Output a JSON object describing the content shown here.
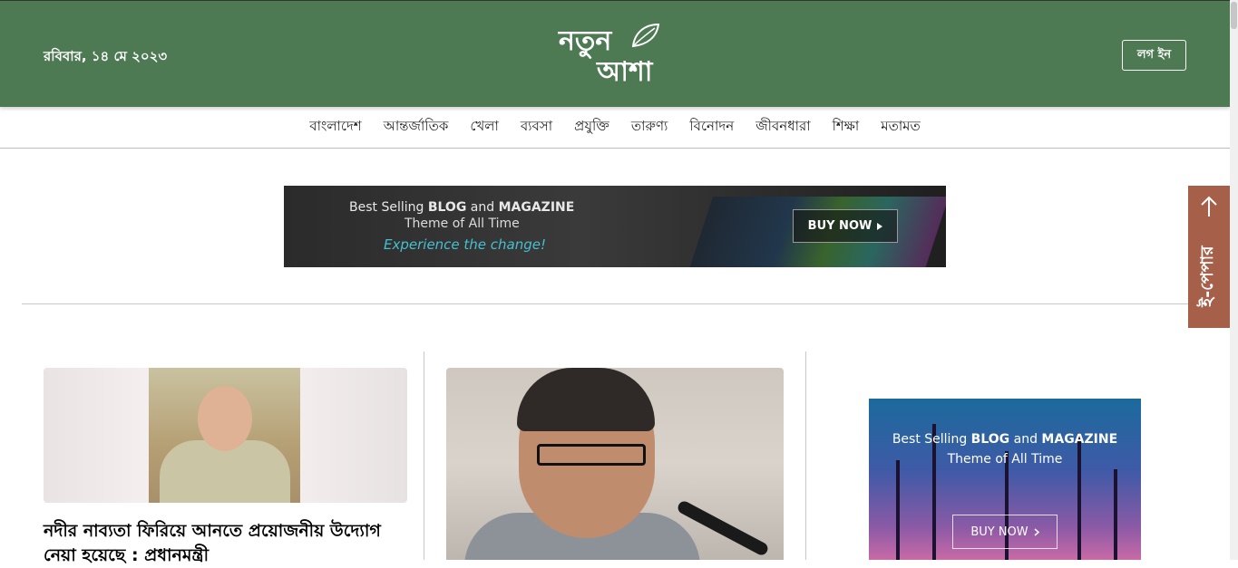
{
  "header": {
    "date": "রবিবার, ১৪ মে ২০২৩",
    "logo_line1": "নতুন",
    "logo_line2": "আশা",
    "login_label": "লগ ইন",
    "bg_color": "#4e7a53"
  },
  "nav": {
    "items": [
      "বাংলাদেশ",
      "আন্তর্জাতিক",
      "খেলা",
      "ব্যবসা",
      "প্রযুক্তি",
      "তারুণ্য",
      "বিনোদন",
      "জীবনধারা",
      "শিক্ষা",
      "মতামত"
    ]
  },
  "top_banner": {
    "line1_prefix": "Best Selling ",
    "line1_b1": "BLOG",
    "line1_and": " and ",
    "line1_b2": "MAGAZINE",
    "line2": "Theme of All Time",
    "tagline": "Experience the change!",
    "button": "BUY NOW"
  },
  "articles": [
    {
      "headline": "নদীর নাব্যতা ফিরিয়ে আনতে প্রয়োজনীয় উদ্যোগ নেয়া হয়েছে : প্রধানমন্ত্রী"
    }
  ],
  "side_banner": {
    "line1_prefix": "Best Selling ",
    "line1_b1": "BLOG",
    "line1_and": " and ",
    "line1_b2": "MAGAZINE",
    "line2": "Theme of All Time",
    "button": "BUY NOW"
  },
  "epaper": {
    "label": "ই-পেপার",
    "icon": "arrow-up-icon",
    "color": "#a6604a"
  }
}
